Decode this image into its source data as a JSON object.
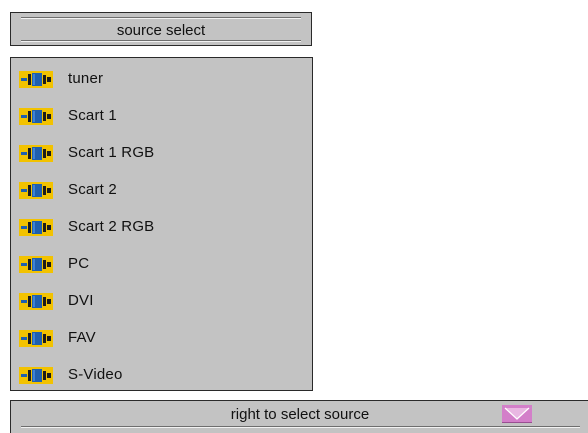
{
  "header": {
    "title": "source select"
  },
  "sources": [
    {
      "label": "tuner",
      "icon": "source-connector-icon"
    },
    {
      "label": "Scart 1",
      "icon": "source-connector-icon"
    },
    {
      "label": "Scart 1 RGB",
      "icon": "source-connector-icon"
    },
    {
      "label": "Scart 2",
      "icon": "source-connector-icon"
    },
    {
      "label": "Scart 2 RGB",
      "icon": "source-connector-icon"
    },
    {
      "label": "PC",
      "icon": "source-connector-icon"
    },
    {
      "label": "DVI",
      "icon": "source-connector-icon"
    },
    {
      "label": "FAV",
      "icon": "source-connector-icon"
    },
    {
      "label": "S-Video",
      "icon": "source-connector-icon"
    }
  ],
  "footer": {
    "hint": "right to select source",
    "icon": "down-arrow-icon"
  },
  "colors": {
    "panel_bg": "#c3c3c3",
    "icon_yellow": "#f2c200",
    "icon_blue": "#1f5fae",
    "arrow_pink": "#d37fc9"
  }
}
